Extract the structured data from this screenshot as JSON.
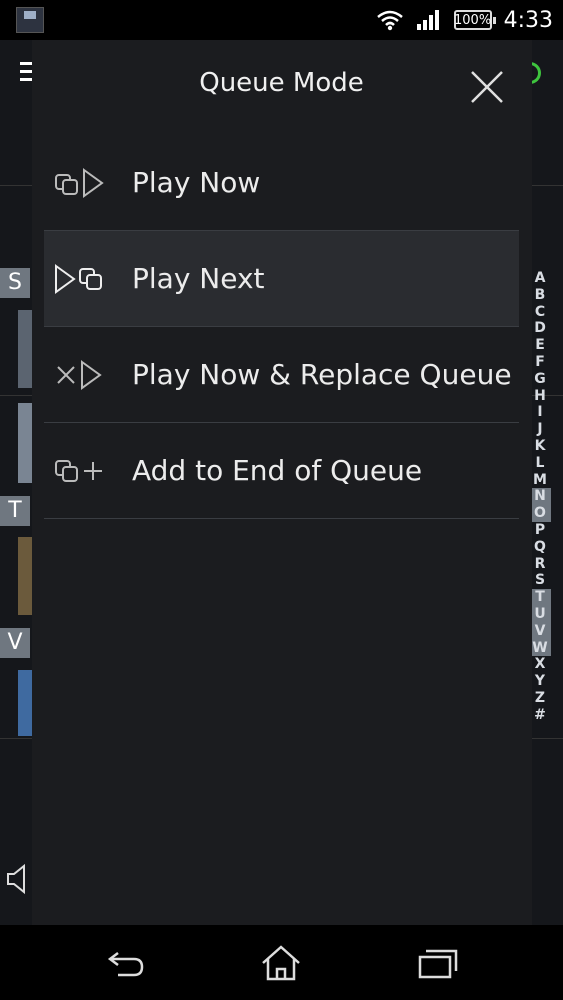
{
  "status_bar": {
    "battery_text": "100%",
    "time": "4:33"
  },
  "background_app": {
    "section_letters": [
      "S",
      "T",
      "V"
    ],
    "alphabet_index": [
      "A",
      "B",
      "C",
      "D",
      "E",
      "F",
      "G",
      "H",
      "I",
      "J",
      "K",
      "L",
      "M",
      "N",
      "O",
      "P",
      "Q",
      "R",
      "S",
      "T",
      "U",
      "V",
      "W",
      "X",
      "Y",
      "Z",
      "#"
    ],
    "highlighted_letters": [
      "N",
      "O",
      "T",
      "U",
      "V",
      "W"
    ]
  },
  "dialog": {
    "title": "Queue Mode",
    "items": [
      {
        "label": "Play Now",
        "icon": "play-now-icon"
      },
      {
        "label": "Play Next",
        "icon": "play-next-icon"
      },
      {
        "label": "Play Now & Replace Queue",
        "icon": "replace-queue-icon"
      },
      {
        "label": "Add to End of Queue",
        "icon": "add-to-queue-icon"
      }
    ],
    "selected_index": 1
  },
  "colors": {
    "accent_green": "#3ec43e",
    "dialog_bg": "#1b1c1f",
    "selected_bg": "#2a2c30"
  }
}
